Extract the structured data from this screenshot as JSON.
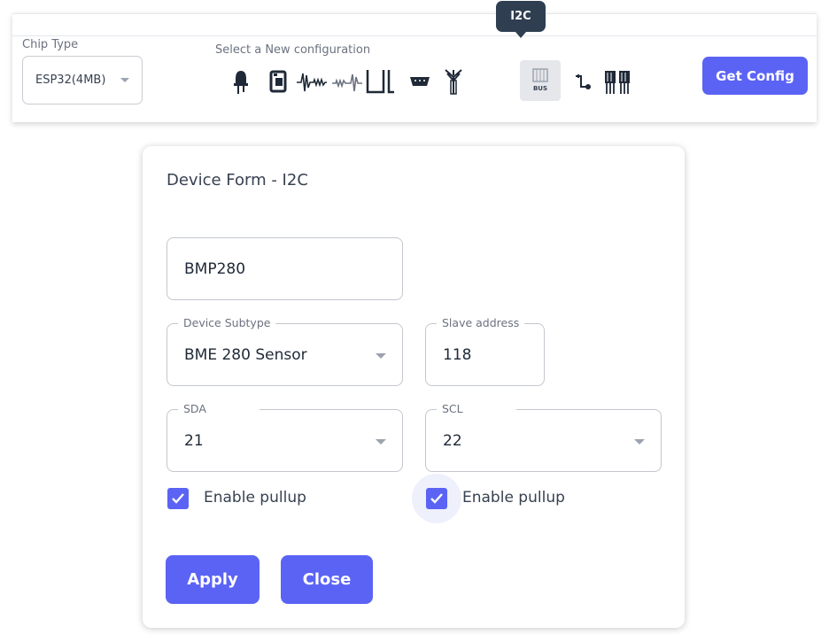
{
  "toolbar": {
    "chip_type_label": "Chip Type",
    "chip_type_value": "ESP32(4MB)",
    "select_config_label": "Select a New configuration",
    "tooltip": "I2C",
    "bus_icon_text": "BUS",
    "get_config_label": "Get Config",
    "icons": [
      "led-icon",
      "relay-icon",
      "pwm-signal-icon",
      "analog-signal-icon",
      "pulse-icon",
      "uart-connector-icon",
      "antenna-icon",
      "i2c-bus-icon",
      "gpio-toggle-icon",
      "ic-chip-icon"
    ]
  },
  "form": {
    "title": "Device Form - I2C",
    "device_name": "BMP280",
    "device_subtype_label": "Device Subtype",
    "device_subtype_value": "BME 280 Sensor",
    "slave_address_label": "Slave address",
    "slave_address_value": "118",
    "sda_label": "SDA",
    "sda_value": "21",
    "scl_label": "SCL",
    "scl_value": "22",
    "sda_pullup_label": "Enable pullup",
    "scl_pullup_label": "Enable pullup",
    "apply_label": "Apply",
    "close_label": "Close"
  },
  "colors": {
    "accent": "#5b63f5",
    "tooltip_bg": "#2f3e51"
  }
}
